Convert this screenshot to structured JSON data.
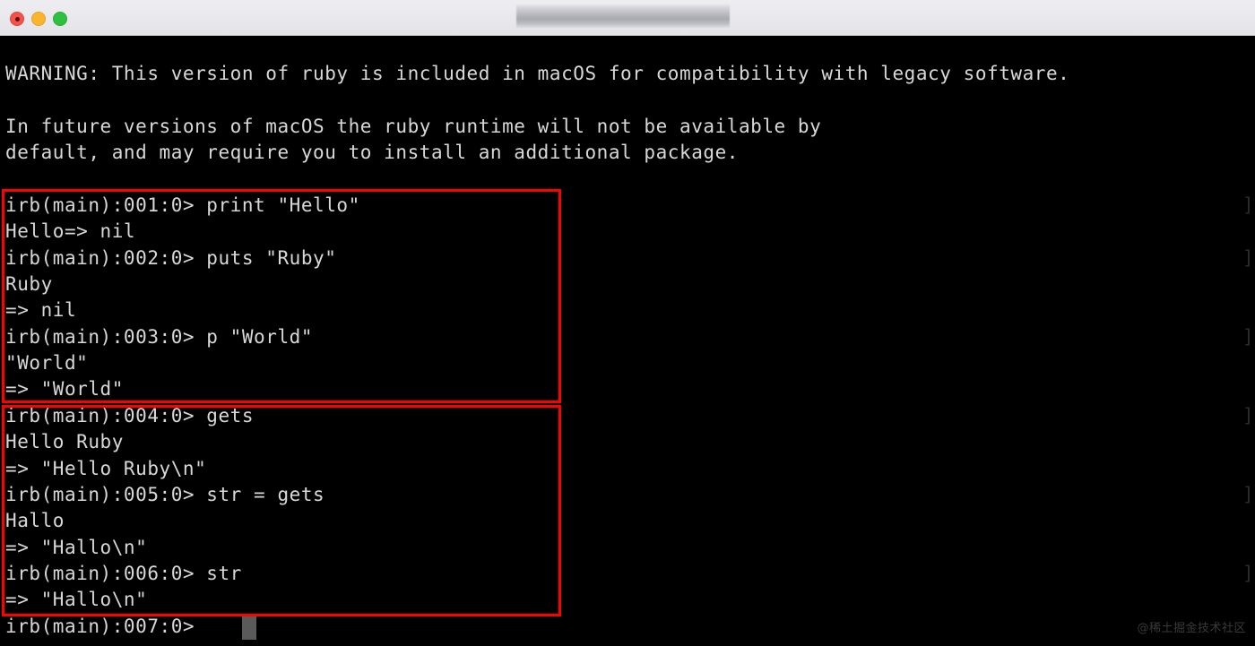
{
  "window": {
    "title_redacted": true,
    "traffic_lights": [
      {
        "name": "close",
        "color": "#f5534a",
        "label": "Close"
      },
      {
        "name": "minimize",
        "color": "#f9b52c",
        "label": "Minimize"
      },
      {
        "name": "maximize",
        "color": "#2ec13f",
        "label": "Maximize"
      }
    ]
  },
  "terminal": {
    "background": "#000000",
    "foreground": "#d8d8d8",
    "warning_lines": [
      "WARNING: This version of ruby is included in macOS for compatibility with legacy software.",
      "",
      "In future versions of macOS the ruby runtime will not be available by",
      "default, and may require you to install an additional package."
    ],
    "session_lines": [
      "irb(main):001:0> print \"Hello\"",
      "Hello=> nil",
      "irb(main):002:0> puts \"Ruby\"",
      "Ruby",
      "=> nil",
      "irb(main):003:0> p \"World\"",
      "\"World\"",
      "=> \"World\"",
      "irb(main):004:0> gets",
      "Hello Ruby",
      "=> \"Hello Ruby\\n\"",
      "irb(main):005:0> str = gets",
      "Hallo",
      "=> \"Hallo\\n\"",
      "irb(main):006:0> str",
      "=> \"Hallo\\n\"",
      "irb(main):007:0> "
    ],
    "prompt_current": "irb(main):007:0> ",
    "edge_artifacts": [
      "]",
      "]",
      "]",
      "]",
      "]",
      "]"
    ],
    "cursor": {
      "shape": "block",
      "color": "#5a5a5a"
    }
  },
  "highlights": [
    {
      "name": "output-methods-box",
      "color": "#ff0000",
      "lines": [
        "irb(main):001:0> print \"Hello\"",
        "Hello=> nil",
        "irb(main):002:0> puts \"Ruby\"",
        "Ruby",
        "=> nil",
        "irb(main):003:0> p \"World\"",
        "\"World\"",
        "=> \"World\""
      ]
    },
    {
      "name": "input-methods-box",
      "color": "#ff0000",
      "lines": [
        "irb(main):004:0> gets",
        "Hello Ruby",
        "=> \"Hello Ruby\\n\"",
        "irb(main):005:0> str = gets",
        "Hallo",
        "=> \"Hallo\\n\"",
        "irb(main):006:0> str",
        "=> \"Hallo\\n\""
      ]
    }
  ],
  "watermark": {
    "text": "@稀土掘金技术社区"
  }
}
